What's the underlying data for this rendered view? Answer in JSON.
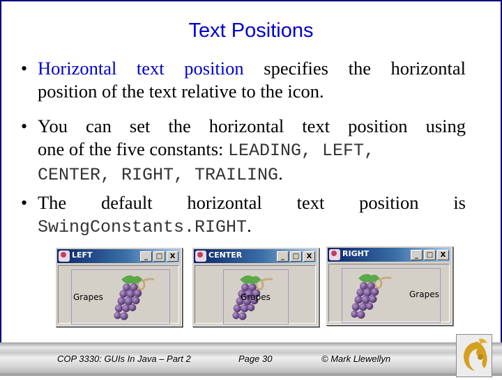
{
  "slide": {
    "title": "Text Positions",
    "bullets": [
      {
        "highlight": "Horizontal text position",
        "text_line1": " specifies the horizontal",
        "text_line2": "position of the text relative to the icon."
      },
      {
        "text_line1": "You can set the horizontal text position using",
        "text_line2_prefix": "one of the five constants: ",
        "code_line2": "LEADING, LEFT,",
        "code_line3": "CENTER, RIGHT, TRAILING",
        "suffix_line3": "."
      },
      {
        "text_line1": "The default horizontal text position is",
        "code_line2": "SwingConstants.RIGHT",
        "suffix_line2": "."
      }
    ]
  },
  "windows": [
    {
      "title": "LEFT",
      "label": "Grapes",
      "minimize": "_",
      "maximize": "□",
      "close": "X"
    },
    {
      "title": "CENTER",
      "label": "Grapes",
      "minimize": "_",
      "maximize": "□",
      "close": "X"
    },
    {
      "title": "RIGHT",
      "label": "Grapes",
      "minimize": "_",
      "maximize": "□",
      "close": "X"
    }
  ],
  "footer": {
    "course": "COP 3330:  GUIs In Java – Part 2",
    "page": "Page 30",
    "author": "© Mark Llewellyn"
  },
  "colors": {
    "title": "#0000cc",
    "frame": "#00007a",
    "highlight": "#0000cc"
  }
}
